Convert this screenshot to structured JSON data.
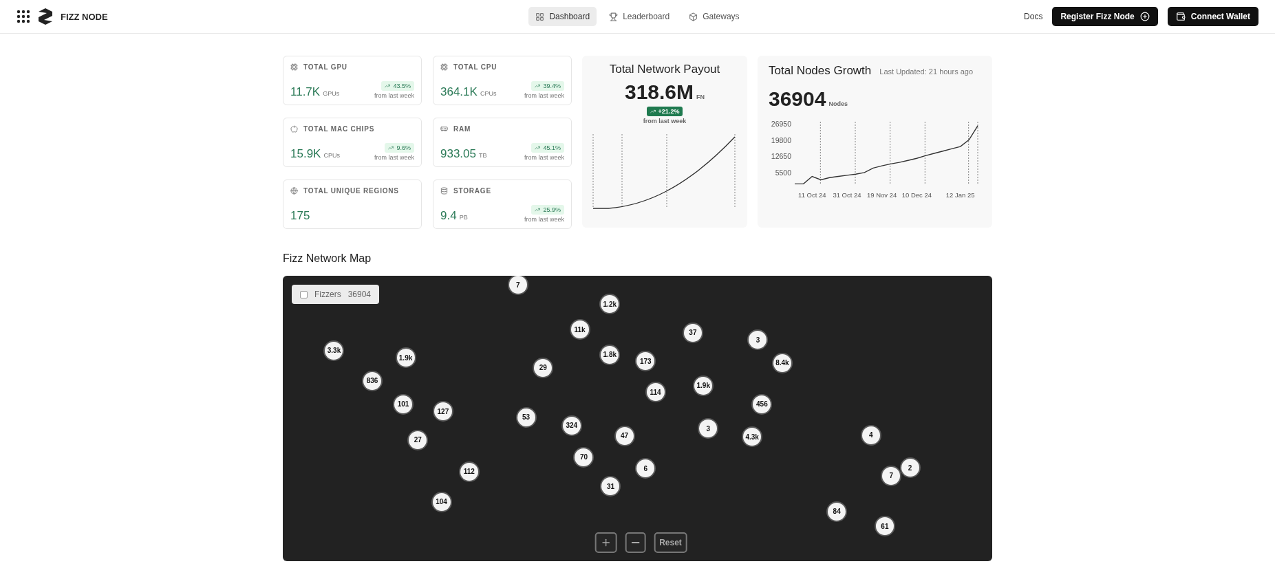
{
  "header": {
    "app_name": "FIZZ NODE",
    "nav": [
      {
        "label": "Dashboard",
        "kind": "dashboard",
        "selected": true
      },
      {
        "label": "Leaderboard",
        "kind": "leaderboard",
        "selected": false
      },
      {
        "label": "Gateways",
        "kind": "gateways",
        "selected": false
      }
    ],
    "docs": "Docs",
    "actions": [
      {
        "label": "Register Fizz Node",
        "kind": "register"
      },
      {
        "label": "Connect Wallet",
        "kind": "wallet"
      }
    ]
  },
  "stats": [
    {
      "kind": "gpu",
      "title": "TOTAL GPU",
      "value": "11.7K",
      "unit": "GPUs",
      "change": "43.5%",
      "note": "from last week"
    },
    {
      "kind": "cpu",
      "title": "TOTAL CPU",
      "value": "364.1K",
      "unit": "CPUs",
      "change": "39.4%",
      "note": "from last week"
    },
    {
      "kind": "mac",
      "title": "TOTAL MAC CHIPS",
      "value": "15.9K",
      "unit": "CPUs",
      "change": "9.6%",
      "note": "from last week"
    },
    {
      "kind": "ram",
      "title": "RAM",
      "value": "933.05",
      "unit": "TB",
      "change": "45.1%",
      "note": "from last week"
    },
    {
      "kind": "regions",
      "title": "TOTAL UNIQUE REGIONS",
      "value": "175"
    },
    {
      "kind": "storage",
      "title": "STORAGE",
      "value": "9.4",
      "unit": "PB",
      "change": "25.9%",
      "note": "from last week"
    }
  ],
  "payout": {
    "title": "Total Network Payout",
    "value": "318.6M",
    "unit": "FN",
    "change": "+21.2%",
    "note": "from last week"
  },
  "growth": {
    "title": "Total Nodes Growth",
    "updated": "Last Updated: 21 hours ago",
    "value": "36904",
    "unit": "Nodes",
    "chart_data": {
      "type": "line",
      "categories": [
        null,
        null,
        "11 Oct 24",
        null,
        null,
        null,
        "31 Oct 24",
        null,
        null,
        null,
        "19 Nov 24",
        null,
        null,
        null,
        "10 Dec 24",
        null,
        null,
        null,
        null,
        "12 Jan 25",
        null,
        null
      ],
      "series": [
        {
          "color": "#333333",
          "values": [
            500,
            500,
            3800,
            2300,
            3300,
            3800,
            4300,
            4800,
            5500,
            7500,
            8500,
            9300,
            10000,
            10900,
            11800,
            13000,
            14000,
            15000,
            16000,
            17000,
            20000,
            26200
          ]
        }
      ],
      "ylim": [
        0,
        28000
      ],
      "grid": true,
      "yticks": [
        5500,
        12650,
        19800,
        26950
      ]
    }
  },
  "map": {
    "title": "Fizz Network Map",
    "legend": {
      "label": "Fizzers",
      "count": "36904",
      "checked": false
    },
    "clusters": [
      {
        "count": "7"
      },
      {
        "count": "1.2k"
      },
      {
        "count": "11k"
      },
      {
        "count": "37"
      },
      {
        "count": "3"
      },
      {
        "count": "3.3k"
      },
      {
        "count": "1.9k"
      },
      {
        "count": "1.8k"
      },
      {
        "count": "173"
      },
      {
        "count": "8.4k"
      },
      {
        "count": "29"
      },
      {
        "count": "836"
      },
      {
        "count": "114"
      },
      {
        "count": "1.9k"
      },
      {
        "count": "456"
      },
      {
        "count": "101"
      },
      {
        "count": "127"
      },
      {
        "count": "53"
      },
      {
        "count": "324"
      },
      {
        "count": "3"
      },
      {
        "count": "4.3k"
      },
      {
        "count": "4"
      },
      {
        "count": "27"
      },
      {
        "count": "47"
      },
      {
        "count": "70"
      },
      {
        "count": "6"
      },
      {
        "count": "2"
      },
      {
        "count": "7"
      },
      {
        "count": "112"
      },
      {
        "count": "31"
      },
      {
        "count": "104"
      },
      {
        "count": "84"
      },
      {
        "count": "61"
      }
    ],
    "reset": "Reset"
  }
}
